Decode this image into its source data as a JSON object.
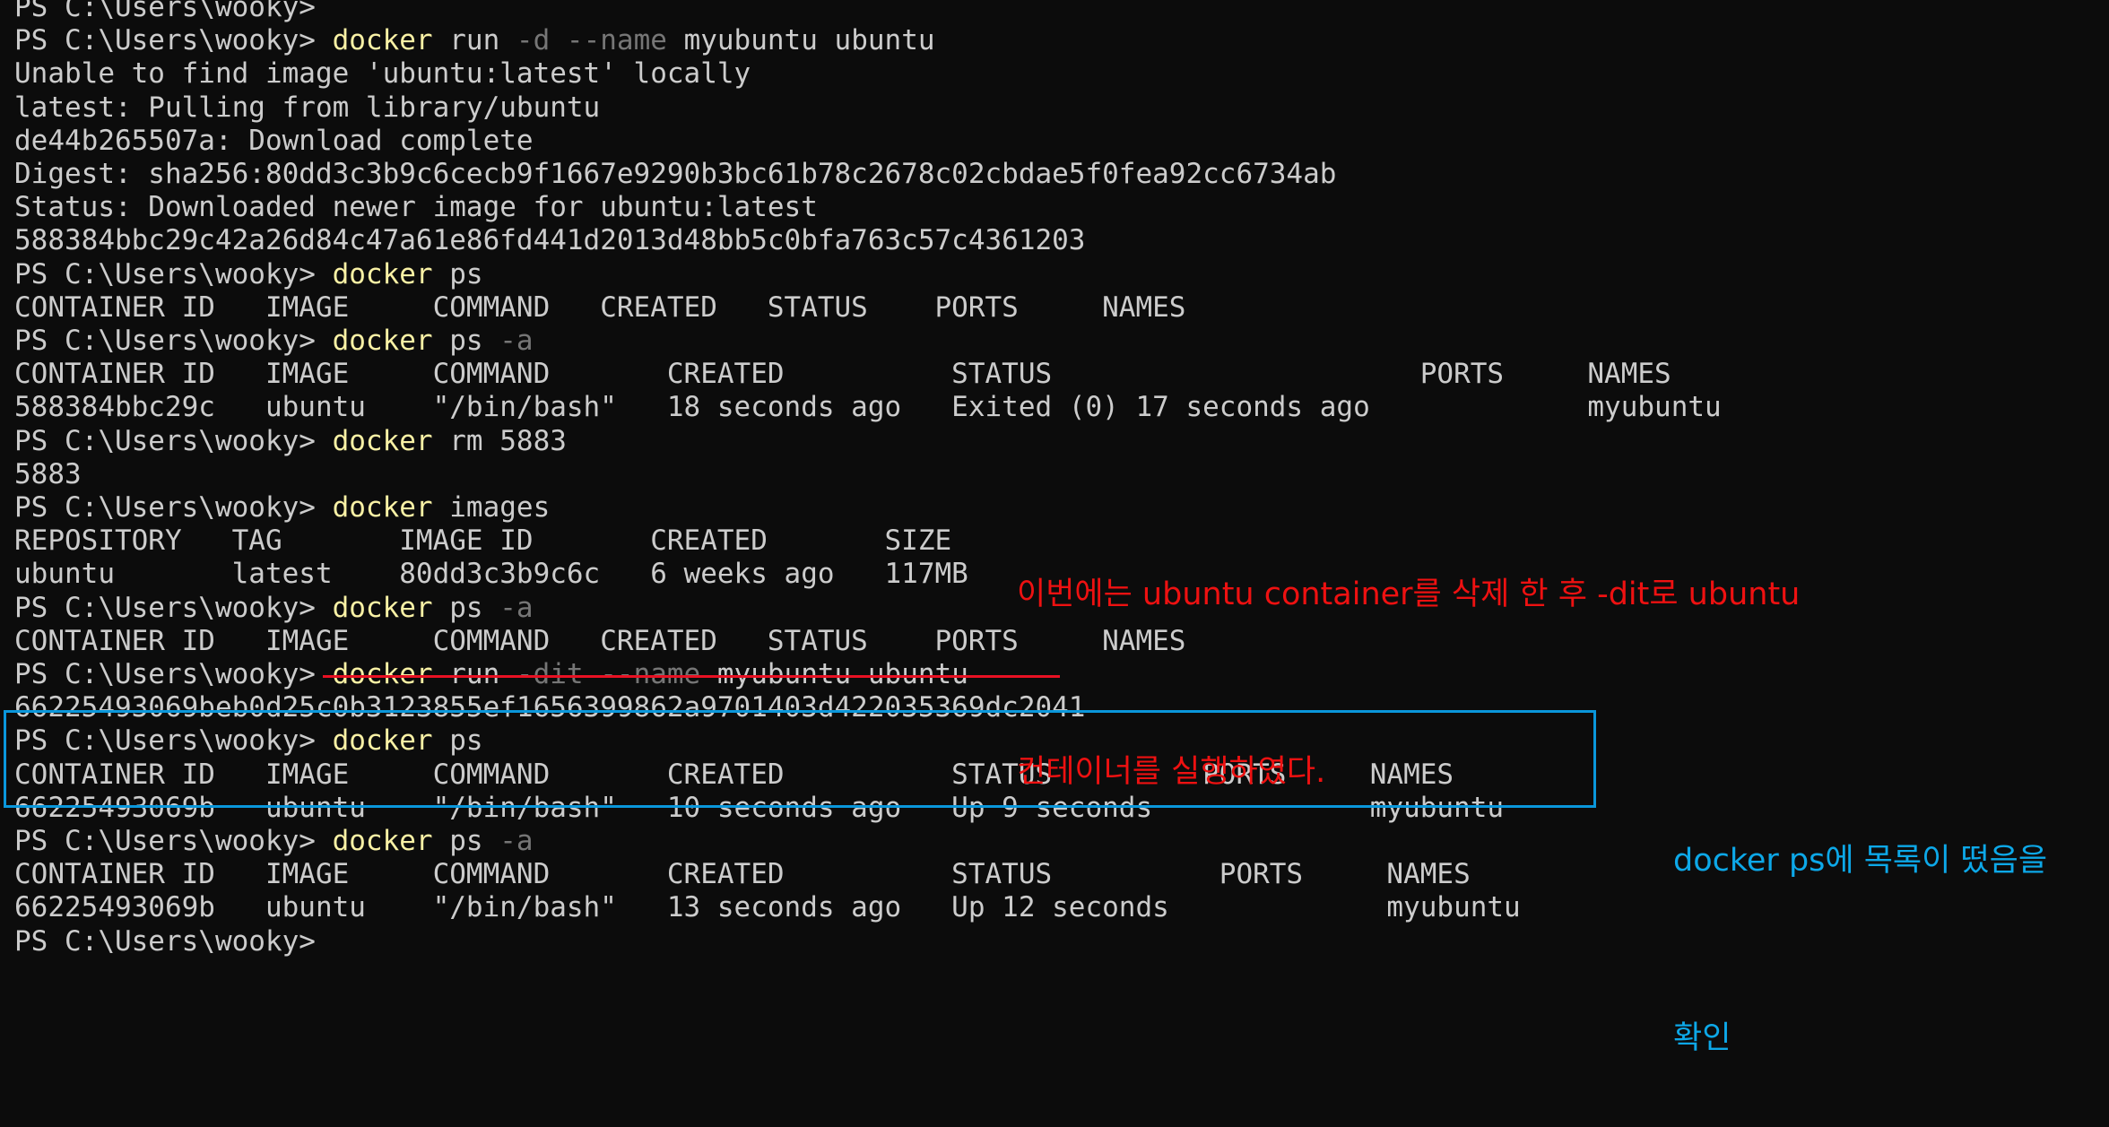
{
  "terminal": {
    "lines": [
      {
        "text": "PS C:\\Users\\wooky>"
      },
      {
        "prompt": "PS C:\\Users\\wooky> ",
        "cmd": "docker",
        "args": [
          {
            "t": " run ",
            "k": "arg"
          },
          {
            "t": "-d --name",
            "k": "flag"
          },
          {
            "t": " myubuntu ubuntu",
            "k": "arg"
          }
        ]
      },
      {
        "text": "Unable to find image 'ubuntu:latest' locally"
      },
      {
        "text": "latest: Pulling from library/ubuntu"
      },
      {
        "text": "de44b265507a: Download complete"
      },
      {
        "text": "Digest: sha256:80dd3c3b9c6cecb9f1667e9290b3bc61b78c2678c02cbdae5f0fea92cc6734ab"
      },
      {
        "text": "Status: Downloaded newer image for ubuntu:latest"
      },
      {
        "text": "588384bbc29c42a26d84c47a61e86fd441d2013d48bb5c0bfa763c57c4361203"
      },
      {
        "prompt": "PS C:\\Users\\wooky> ",
        "cmd": "docker",
        "args": [
          {
            "t": " ps",
            "k": "arg"
          }
        ]
      },
      {
        "text": "CONTAINER ID   IMAGE     COMMAND   CREATED   STATUS    PORTS     NAMES"
      },
      {
        "prompt": "PS C:\\Users\\wooky> ",
        "cmd": "docker",
        "args": [
          {
            "t": " ps ",
            "k": "arg"
          },
          {
            "t": "-a",
            "k": "flag"
          }
        ]
      },
      {
        "text": "CONTAINER ID   IMAGE     COMMAND       CREATED          STATUS                      PORTS     NAMES"
      },
      {
        "text": "588384bbc29c   ubuntu    \"/bin/bash\"   18 seconds ago   Exited (0) 17 seconds ago             myubuntu"
      },
      {
        "prompt": "PS C:\\Users\\wooky> ",
        "cmd": "docker",
        "args": [
          {
            "t": " rm 5883",
            "k": "arg"
          }
        ]
      },
      {
        "text": "5883"
      },
      {
        "prompt": "PS C:\\Users\\wooky> ",
        "cmd": "docker",
        "args": [
          {
            "t": " images",
            "k": "arg"
          }
        ]
      },
      {
        "text": "REPOSITORY   TAG       IMAGE ID       CREATED       SIZE"
      },
      {
        "text": "ubuntu       latest    80dd3c3b9c6c   6 weeks ago   117MB"
      },
      {
        "prompt": "PS C:\\Users\\wooky> ",
        "cmd": "docker",
        "args": [
          {
            "t": " ps ",
            "k": "arg"
          },
          {
            "t": "-a",
            "k": "flag"
          }
        ]
      },
      {
        "text": "CONTAINER ID   IMAGE     COMMAND   CREATED   STATUS    PORTS     NAMES"
      },
      {
        "prompt": "PS C:\\Users\\wooky> ",
        "cmd": "docker",
        "args": [
          {
            "t": " run ",
            "k": "arg"
          },
          {
            "t": "-dit --name",
            "k": "flag"
          },
          {
            "t": " myubuntu ubuntu",
            "k": "arg"
          }
        ]
      },
      {
        "text": "66225493069beb0d25c0b3123855ef1656399862a9701403d422035369dc2041"
      },
      {
        "prompt": "PS C:\\Users\\wooky> ",
        "cmd": "docker",
        "args": [
          {
            "t": " ps",
            "k": "arg"
          }
        ]
      },
      {
        "text": "CONTAINER ID   IMAGE     COMMAND       CREATED          STATUS         PORTS     NAMES"
      },
      {
        "text": "66225493069b   ubuntu    \"/bin/bash\"   10 seconds ago   Up 9 seconds             myubuntu"
      },
      {
        "prompt": "PS C:\\Users\\wooky> ",
        "cmd": "docker",
        "args": [
          {
            "t": " ps ",
            "k": "arg"
          },
          {
            "t": "-a",
            "k": "flag"
          }
        ]
      },
      {
        "text": "CONTAINER ID   IMAGE     COMMAND       CREATED          STATUS          PORTS     NAMES"
      },
      {
        "text": "66225493069b   ubuntu    \"/bin/bash\"   13 seconds ago   Up 12 seconds             myubuntu"
      },
      {
        "text": "PS C:\\Users\\wooky>"
      }
    ]
  },
  "annotations": {
    "red": {
      "line1": "이번에는 ubuntu container를 삭제 한 후 -dit로 ubuntu",
      "line2": "컨테이너를 실행하였다.",
      "color": "#ee1111"
    },
    "blue": {
      "line1": "docker ps에 목록이 떴음을",
      "line2": "확인",
      "color": "#0da8e8"
    }
  },
  "colors": {
    "background": "#0c0c0c",
    "foreground": "#cccccc",
    "command": "#f9f1a5",
    "flag": "#767676",
    "underline": "#e81123",
    "highlight_box": "#0a97db"
  }
}
